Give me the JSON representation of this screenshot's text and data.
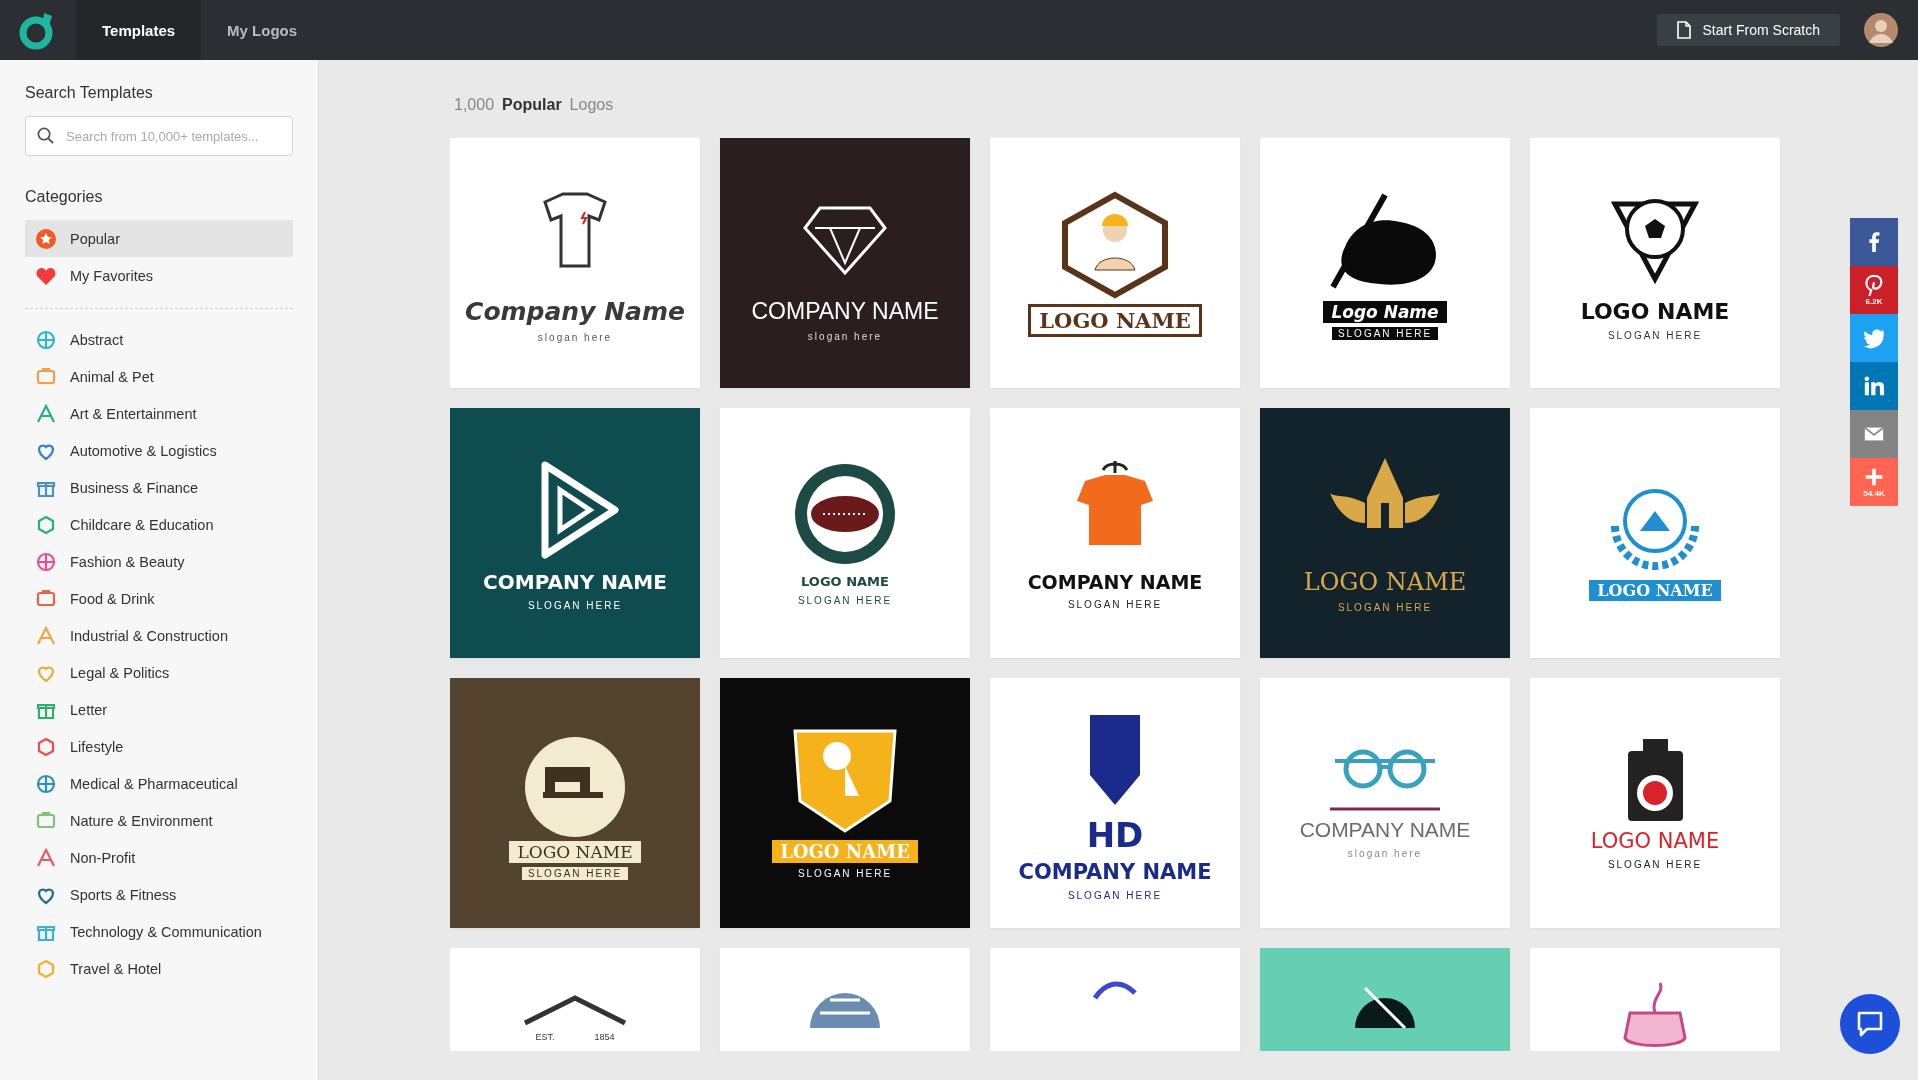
{
  "nav": {
    "tabs": [
      {
        "label": "Templates",
        "selected": true
      },
      {
        "label": "My Logos",
        "selected": false
      }
    ],
    "action": "Start From Scratch"
  },
  "sidebar": {
    "search_title": "Search Templates",
    "search": {
      "placeholder": "Search from 10,000+ templates..."
    },
    "categories_title": "Categories",
    "pinned": [
      {
        "label": "Popular",
        "selected": true,
        "color": "#f05a28"
      },
      {
        "label": "My Favorites",
        "selected": false,
        "color": "#ee3b3b"
      }
    ],
    "categories": [
      {
        "label": "Abstract",
        "color": "#2bb5c9"
      },
      {
        "label": "Animal & Pet",
        "color": "#f0a04b"
      },
      {
        "label": "Art & Entertainment",
        "color": "#27b08a"
      },
      {
        "label": "Automotive & Logistics",
        "color": "#3a7fc1"
      },
      {
        "label": "Business & Finance",
        "color": "#4a8fd0"
      },
      {
        "label": "Childcare & Education",
        "color": "#2fae7a"
      },
      {
        "label": "Fashion & Beauty",
        "color": "#e8508a"
      },
      {
        "label": "Food & Drink",
        "color": "#e8634a"
      },
      {
        "label": "Industrial & Construction",
        "color": "#f0a540"
      },
      {
        "label": "Legal & Politics",
        "color": "#e0b040"
      },
      {
        "label": "Letter",
        "color": "#2fae6a"
      },
      {
        "label": "Lifestyle",
        "color": "#e8504a"
      },
      {
        "label": "Medical & Pharmaceutical",
        "color": "#2a8fc0"
      },
      {
        "label": "Nature & Environment",
        "color": "#7cc47a"
      },
      {
        "label": "Non-Profit",
        "color": "#e85a6a"
      },
      {
        "label": "Sports & Fitness",
        "color": "#1f6f8f"
      },
      {
        "label": "Technology & Communication",
        "color": "#3ab0d8"
      },
      {
        "label": "Travel & Hotel",
        "color": "#f5b030"
      }
    ]
  },
  "heading": {
    "count": "1,000",
    "category": "Popular",
    "noun": "Logos"
  },
  "tiles": [
    {
      "kind": "tshirt",
      "color": "#ffffff",
      "name": "Company Name",
      "slogan": "slogan here"
    },
    {
      "kind": "diamond",
      "color": "#2a1f1e",
      "name": "COMPANY NAME",
      "slogan": "slogan here"
    },
    {
      "kind": "worker",
      "color": "#ffffff",
      "name": "LOGO NAME"
    },
    {
      "kind": "guitar",
      "color": "#ffffff",
      "name": "Logo Name",
      "slogan": "SLOGAN HERE"
    },
    {
      "kind": "soccer",
      "color": "#ffffff",
      "name": "LOGO NAME",
      "slogan": "SLOGAN HERE"
    },
    {
      "kind": "play",
      "color": "#0f4c50",
      "name": "COMPANY NAME",
      "slogan": "SLOGAN HERE"
    },
    {
      "kind": "football",
      "color": "#ffffff",
      "name": "LOGO NAME",
      "slogan": "SLOGAN HERE"
    },
    {
      "kind": "shirt",
      "color": "#ffffff",
      "name": "COMPANY NAME",
      "slogan": "SLOGAN HERE"
    },
    {
      "kind": "helmet",
      "color": "#13232c",
      "name": "LOGO NAME",
      "slogan": "SLOGAN HERE"
    },
    {
      "kind": "laurel",
      "color": "#ffffff",
      "name": "LOGO NAME"
    },
    {
      "kind": "sewing",
      "color": "#54432f",
      "name": "LOGO NAME",
      "slogan": "SLOGAN HERE"
    },
    {
      "kind": "mic",
      "color": "#0b0b0b",
      "name": "LOGO NAME",
      "slogan": "SLOGAN HERE"
    },
    {
      "kind": "monogram",
      "color": "#ffffff",
      "monogram": "HD",
      "name": "COMPANY NAME",
      "slogan": "SLOGAN HERE"
    },
    {
      "kind": "glasses",
      "color": "#ffffff",
      "name": "COMPANY NAME",
      "slogan": "slogan here"
    },
    {
      "kind": "camera",
      "color": "#ffffff",
      "name": "LOGO NAME",
      "slogan": "SLOGAN HERE"
    },
    {
      "kind": "crest",
      "color": "#ffffff",
      "marks": [
        "EST.",
        "1854"
      ]
    },
    {
      "kind": "globe",
      "color": "#ffffff"
    },
    {
      "kind": "swoosh",
      "color": "#ffffff"
    },
    {
      "kind": "planet",
      "color": "#66cfb3"
    },
    {
      "kind": "cup",
      "color": "#ffffff"
    }
  ],
  "share": [
    {
      "kind": "facebook",
      "color": "#3b5998"
    },
    {
      "kind": "pinterest",
      "color": "#cb2027",
      "count": "6.2K"
    },
    {
      "kind": "twitter",
      "color": "#1da1f2"
    },
    {
      "kind": "linkedin",
      "color": "#0077b5"
    },
    {
      "kind": "email",
      "color": "#848484"
    },
    {
      "kind": "more",
      "color": "#ff6550",
      "count": "54.4K"
    }
  ]
}
